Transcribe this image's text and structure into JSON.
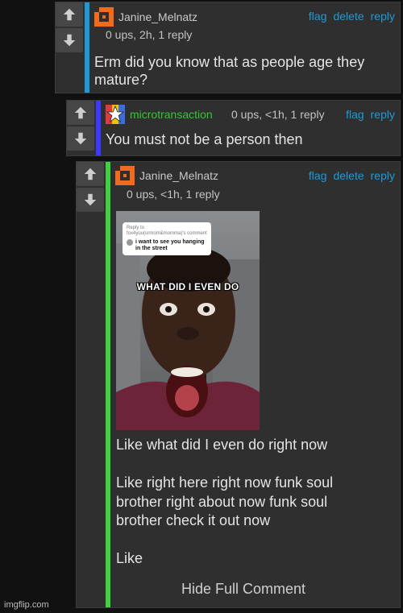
{
  "comments": [
    {
      "username": "Janine_Melnatz",
      "meta": "0 ups, 2h, 1 reply",
      "actions": [
        "flag",
        "delete",
        "reply"
      ],
      "text": "Erm did you know that as people age they\nmature?",
      "stripe_color": "#1e9bd6",
      "avatar_color": "#f26b1d"
    },
    {
      "username": "microtransaction",
      "meta": "0 ups, <1h, 1 reply",
      "actions": [
        "flag",
        "reply"
      ],
      "text": "You must not be a person then",
      "stripe_color": "#3a3aff",
      "username_color": "#34c734"
    },
    {
      "username": "Janine_Melnatz",
      "meta": "0 ups, <1h, 1 reply",
      "actions": [
        "flag",
        "delete",
        "reply"
      ],
      "meme": {
        "reply_label": "Reply to",
        "reply_user": "fox4you(urmom&momma)'s comment",
        "reply_text": "i want to see you hanging in the street",
        "caption": "WHAT DID I EVEN DO"
      },
      "text": "Like what did I even do right now\n\nLike right here right now funk soul\nbrother right about now funk soul\nbrother check it out now\n\nLike",
      "hide_label": "Hide Full Comment",
      "stripe_color": "#3fd13f",
      "avatar_color": "#f26b1d"
    }
  ],
  "icons": {
    "upvote": "arrow-up-icon",
    "downvote": "arrow-down-icon"
  },
  "watermark": "imgflip.com"
}
